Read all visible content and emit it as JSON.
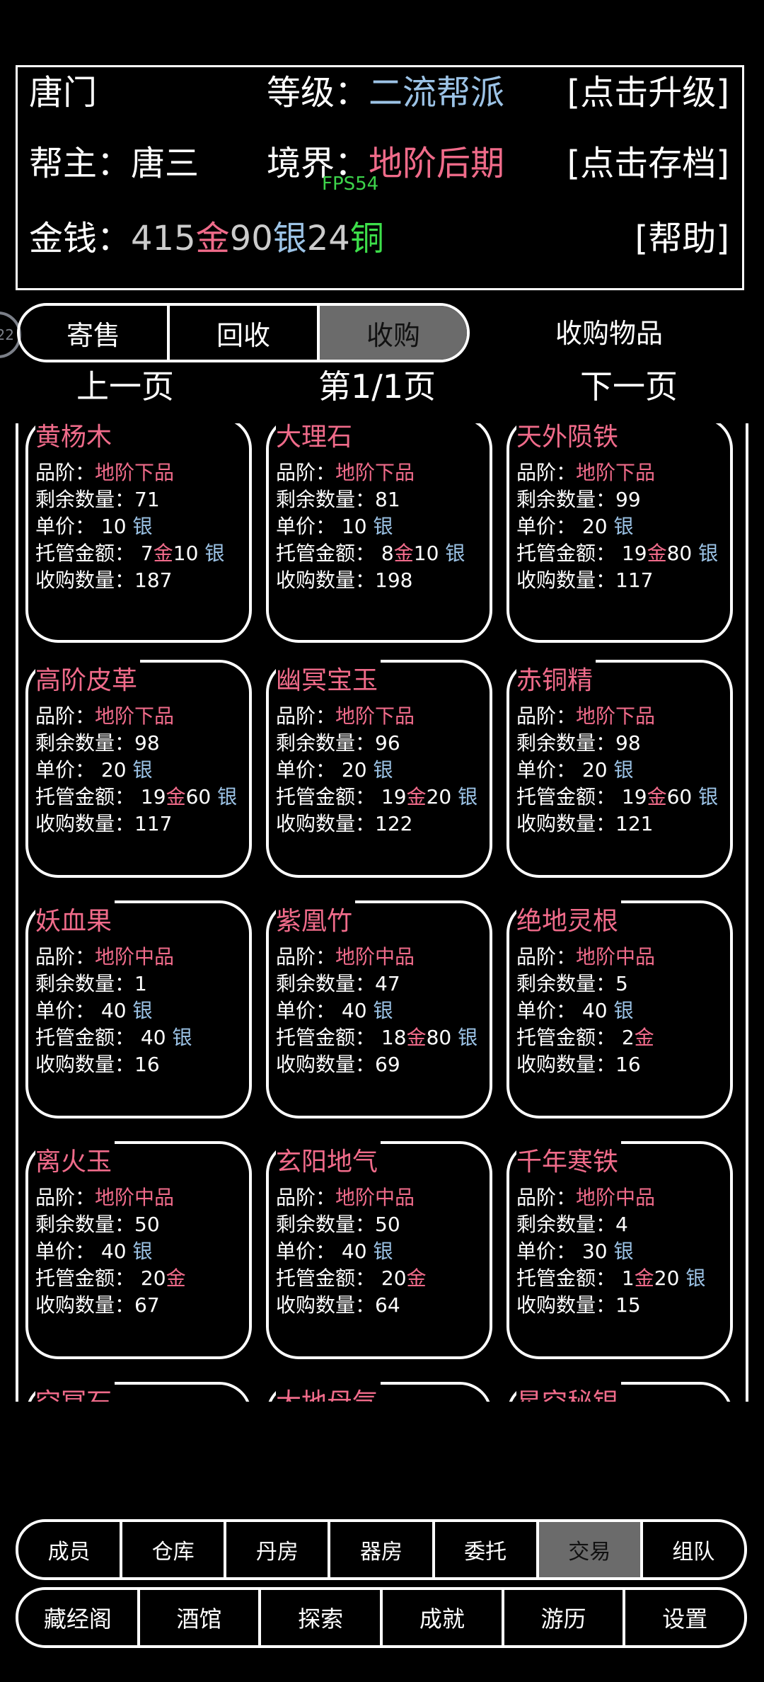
{
  "header": {
    "sect_name": "唐门",
    "level_label": "等级：",
    "level_value": "二流帮派",
    "upgrade_button": "[点击升级]",
    "leader_label": "帮主：",
    "leader_name": "唐三",
    "realm_label": "境界：",
    "realm_value": "地阶后期",
    "save_button": "[点击存档]",
    "fps": "FPS54",
    "money_label": "金钱：",
    "gold_amount": "415",
    "gold_unit": "金",
    "silver_amount": "90",
    "silver_unit": "银",
    "copper_amount": "24",
    "copper_unit": "铜",
    "help_button": "[帮助]"
  },
  "tabs": [
    "寄售",
    "回收",
    "收购"
  ],
  "active_tab": 2,
  "side_badge": "22",
  "page_label": "收购物品",
  "pager": {
    "prev": "上一页",
    "current": "第1/1页",
    "next": "下一页"
  },
  "labels": {
    "grade": "品阶：",
    "remaining": "剩余数量：",
    "unit_price": "单价：",
    "escrow": "托管金额：",
    "buy_qty": "收购数量："
  },
  "items": [
    {
      "name": "黄杨木",
      "grade": "地阶下品",
      "remaining": "71",
      "price": "10",
      "price_unit": "银",
      "escrow_gold": "7",
      "escrow_silver": "10",
      "buy_qty": "187"
    },
    {
      "name": "大理石",
      "grade": "地阶下品",
      "remaining": "81",
      "price": "10",
      "price_unit": "银",
      "escrow_gold": "8",
      "escrow_silver": "10",
      "buy_qty": "198"
    },
    {
      "name": "天外陨铁",
      "grade": "地阶下品",
      "remaining": "99",
      "price": "20",
      "price_unit": "银",
      "escrow_gold": "19",
      "escrow_silver": "80",
      "buy_qty": "117"
    },
    {
      "name": "高阶皮革",
      "grade": "地阶下品",
      "remaining": "98",
      "price": "20",
      "price_unit": "银",
      "escrow_gold": "19",
      "escrow_silver": "60",
      "buy_qty": "117"
    },
    {
      "name": "幽冥宝玉",
      "grade": "地阶下品",
      "remaining": "96",
      "price": "20",
      "price_unit": "银",
      "escrow_gold": "19",
      "escrow_silver": "20",
      "buy_qty": "122"
    },
    {
      "name": "赤铜精",
      "grade": "地阶下品",
      "remaining": "98",
      "price": "20",
      "price_unit": "银",
      "escrow_gold": "19",
      "escrow_silver": "60",
      "buy_qty": "121"
    },
    {
      "name": "妖血果",
      "grade": "地阶中品",
      "remaining": "1",
      "price": "40",
      "price_unit": "银",
      "escrow_gold": "",
      "escrow_silver": "40",
      "buy_qty": "16"
    },
    {
      "name": "紫凰竹",
      "grade": "地阶中品",
      "remaining": "47",
      "price": "40",
      "price_unit": "银",
      "escrow_gold": "18",
      "escrow_silver": "80",
      "buy_qty": "69"
    },
    {
      "name": "绝地灵根",
      "grade": "地阶中品",
      "remaining": "5",
      "price": "40",
      "price_unit": "银",
      "escrow_gold": "2",
      "escrow_silver": "",
      "buy_qty": "16"
    },
    {
      "name": "离火玉",
      "grade": "地阶中品",
      "remaining": "50",
      "price": "40",
      "price_unit": "银",
      "escrow_gold": "20",
      "escrow_silver": "",
      "buy_qty": "67"
    },
    {
      "name": "玄阳地气",
      "grade": "地阶中品",
      "remaining": "50",
      "price": "40",
      "price_unit": "银",
      "escrow_gold": "20",
      "escrow_silver": "",
      "buy_qty": "64"
    },
    {
      "name": "千年寒铁",
      "grade": "地阶中品",
      "remaining": "4",
      "price": "30",
      "price_unit": "银",
      "escrow_gold": "1",
      "escrow_silver": "20",
      "buy_qty": "15"
    },
    {
      "name": "空冥石",
      "grade": "",
      "remaining": "",
      "price": "",
      "price_unit": "",
      "escrow_gold": "",
      "escrow_silver": "",
      "buy_qty": ""
    },
    {
      "name": "大地母气",
      "grade": "",
      "remaining": "",
      "price": "",
      "price_unit": "",
      "escrow_gold": "",
      "escrow_silver": "",
      "buy_qty": ""
    },
    {
      "name": "星空秘银",
      "grade": "",
      "remaining": "",
      "price": "",
      "price_unit": "",
      "escrow_gold": "",
      "escrow_silver": "",
      "buy_qty": ""
    }
  ],
  "units": {
    "gold": "金",
    "silver": "银"
  },
  "nav_row1": [
    "成员",
    "仓库",
    "丹房",
    "器房",
    "委托",
    "交易",
    "组队"
  ],
  "nav_row1_active": 5,
  "nav_row2": [
    "藏经阁",
    "酒馆",
    "探索",
    "成就",
    "游历",
    "设置"
  ],
  "colors": {
    "gold": "#f06b8a",
    "silver": "#9cc3e6",
    "copper": "#3de04a",
    "tab_active": "#6b6b6b"
  }
}
